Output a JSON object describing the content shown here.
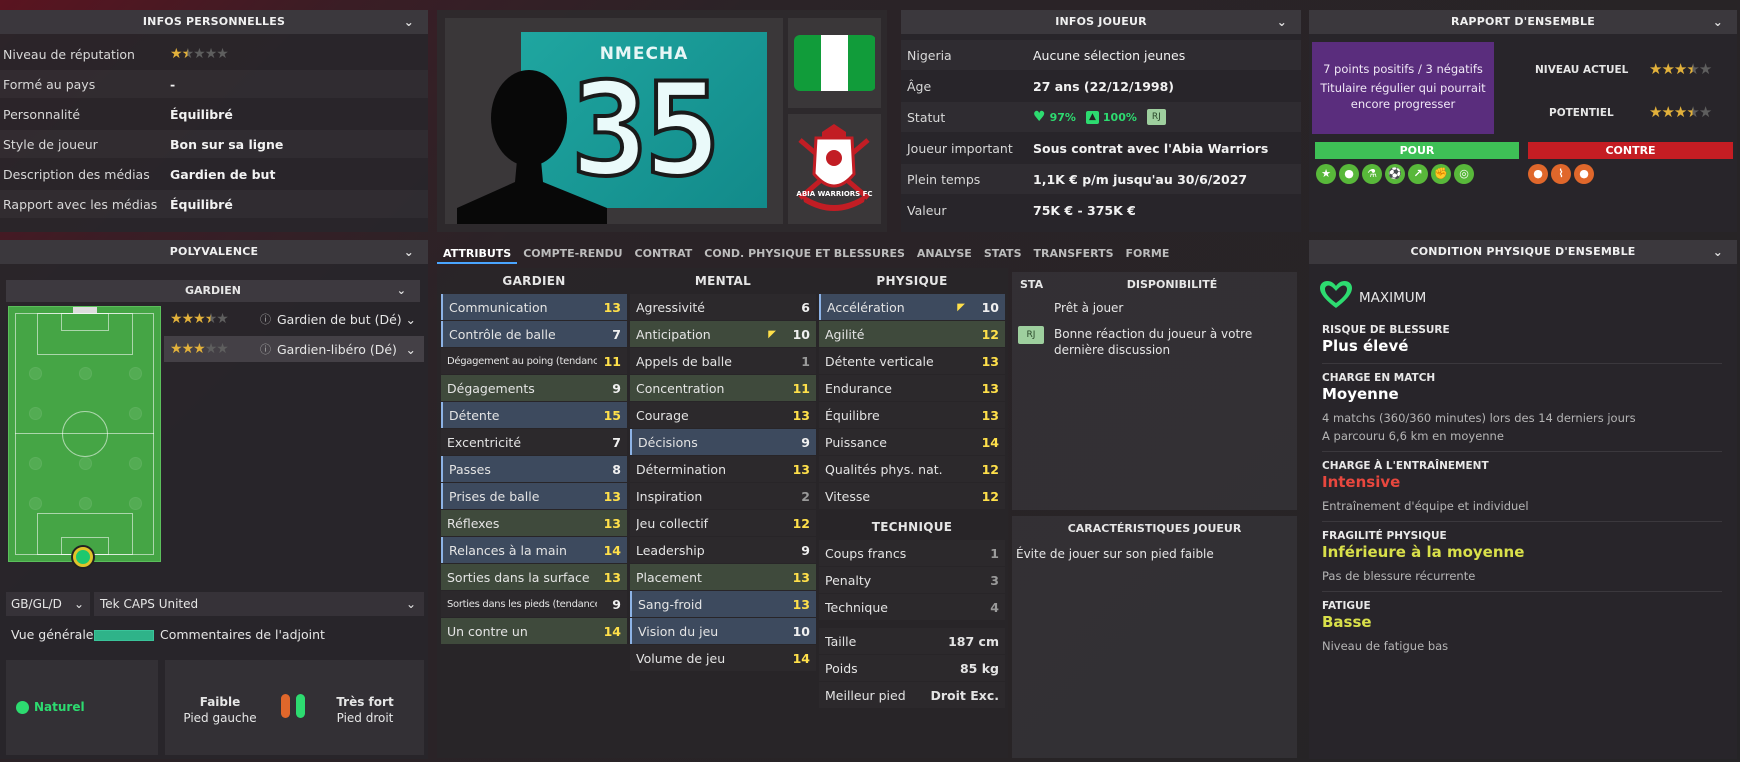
{
  "personal": {
    "title": "INFOS PERSONNELLES",
    "rows": [
      {
        "k": "Niveau de réputation",
        "v": "",
        "stars": 1.5
      },
      {
        "k": "Formé au pays",
        "v": "-"
      },
      {
        "k": "Personnalité",
        "v": "Équilibré"
      },
      {
        "k": "Style de joueur",
        "v": "Bon sur sa ligne"
      },
      {
        "k": "Description des médias",
        "v": "Gardien de but"
      },
      {
        "k": "Rapport avec les médias",
        "v": "Équilibré"
      }
    ]
  },
  "player": {
    "name": "NMECHA",
    "number": "35",
    "club": "ABIA WARRIORS FC",
    "flag_colors": [
      "#119c3a",
      "#ffffff",
      "#119c3a"
    ]
  },
  "info": {
    "title": "INFOS JOUEUR",
    "rows": [
      {
        "k": "Nigeria",
        "v": "Aucune sélection jeunes"
      },
      {
        "k": "Âge",
        "v": "27 ans (22/12/1998)"
      },
      {
        "k": "Statut",
        "heart": "97%",
        "thumb": "100%",
        "badge": "RJ"
      },
      {
        "k": "Joueur important",
        "v": "Sous contrat avec l'Abia Warriors"
      },
      {
        "k": "Plein temps",
        "v": "1,1K € p/m jusqu'au 30/6/2027"
      },
      {
        "k": "Valeur",
        "v": "75K € - 375K €"
      }
    ]
  },
  "overall": {
    "title": "RAPPORT D'ENSEMBLE",
    "summary": "7 points positifs / 3 négatifs",
    "desc": "Titulaire régulier qui pourrait encore progresser",
    "current_label": "NIVEAU ACTUEL",
    "current_stars": 3.5,
    "potential_label": "POTENTIEL",
    "potential_stars": 3.5,
    "pros": "POUR",
    "cons": "CONTRE",
    "pro_icons": [
      "star-icon",
      "ball-icon",
      "flask-icon",
      "kick-icon",
      "trend-icon",
      "strength-icon",
      "target-icon"
    ],
    "con_icons": [
      "ball-icon",
      "foot-icon",
      "ball-icon"
    ]
  },
  "versatility": {
    "title": "POLYVALENCE",
    "group": "GARDIEN",
    "roles": [
      {
        "stars": 3.5,
        "label": "Gardien de but (Dé)"
      },
      {
        "stars": 3,
        "label": "Gardien-libéro (Dé)"
      }
    ]
  },
  "filters": {
    "nation": "GB/GL/D",
    "source": "Tek CAPS United"
  },
  "overview": {
    "label": "Vue générale",
    "comments": "Commentaires de l'adjoint"
  },
  "feet": {
    "natural": "Naturel",
    "left_strength": "Faible",
    "left_label": "Pied gauche",
    "right_strength": "Très fort",
    "right_label": "Pied droit"
  },
  "tabs": [
    "ATTRIBUTS",
    "COMPTE-RENDU",
    "CONTRAT",
    "COND. PHYSIQUE ET BLESSURES",
    "ANALYSE",
    "STATS",
    "TRANSFERTS",
    "FORME"
  ],
  "attr": {
    "gk_title": "GARDIEN",
    "mental_title": "MENTAL",
    "phys_title": "PHYSIQUE",
    "tech_title": "TECHNIQUE",
    "gk": [
      {
        "n": "Communication",
        "v": "13",
        "c": "blue",
        "col": "y"
      },
      {
        "n": "Contrôle de balle",
        "v": "7",
        "c": "blue",
        "col": "w"
      },
      {
        "n": "Dégagement au poing (tendance)",
        "v": "11",
        "c": "plain",
        "col": "y",
        "small": true
      },
      {
        "n": "Dégagements",
        "v": "9",
        "c": "green",
        "col": "w"
      },
      {
        "n": "Détente",
        "v": "15",
        "c": "blue",
        "col": "y"
      },
      {
        "n": "Excentricité",
        "v": "7",
        "c": "plain",
        "col": "w"
      },
      {
        "n": "Passes",
        "v": "8",
        "c": "blue",
        "col": "w"
      },
      {
        "n": "Prises de balle",
        "v": "13",
        "c": "blue",
        "col": "y"
      },
      {
        "n": "Réflexes",
        "v": "13",
        "c": "green",
        "col": "y"
      },
      {
        "n": "Relances à la main",
        "v": "14",
        "c": "blue",
        "col": "y"
      },
      {
        "n": "Sorties dans la surface",
        "v": "13",
        "c": "green",
        "col": "y"
      },
      {
        "n": "Sorties dans les pieds (tendance)",
        "v": "9",
        "c": "plain",
        "col": "w",
        "small": true
      },
      {
        "n": "Un contre un",
        "v": "14",
        "c": "green",
        "col": "y"
      }
    ],
    "mental": [
      {
        "n": "Agressivité",
        "v": "6",
        "c": "plain",
        "col": "w"
      },
      {
        "n": "Anticipation",
        "v": "10",
        "c": "green",
        "col": "w",
        "arrow": true
      },
      {
        "n": "Appels de balle",
        "v": "1",
        "c": "plain",
        "col": "g"
      },
      {
        "n": "Concentration",
        "v": "11",
        "c": "green",
        "col": "y"
      },
      {
        "n": "Courage",
        "v": "13",
        "c": "plain",
        "col": "y"
      },
      {
        "n": "Décisions",
        "v": "9",
        "c": "blue",
        "col": "w"
      },
      {
        "n": "Détermination",
        "v": "13",
        "c": "plain",
        "col": "y"
      },
      {
        "n": "Inspiration",
        "v": "2",
        "c": "plain",
        "col": "g"
      },
      {
        "n": "Jeu collectif",
        "v": "12",
        "c": "plain",
        "col": "y"
      },
      {
        "n": "Leadership",
        "v": "9",
        "c": "plain",
        "col": "w"
      },
      {
        "n": "Placement",
        "v": "13",
        "c": "green",
        "col": "y"
      },
      {
        "n": "Sang-froid",
        "v": "13",
        "c": "blue",
        "col": "y"
      },
      {
        "n": "Vision du jeu",
        "v": "10",
        "c": "blue",
        "col": "w"
      },
      {
        "n": "Volume de jeu",
        "v": "14",
        "c": "plain",
        "col": "y"
      }
    ],
    "phys": [
      {
        "n": "Accélération",
        "v": "10",
        "c": "blue",
        "col": "w",
        "arrow": true
      },
      {
        "n": "Agilité",
        "v": "12",
        "c": "green",
        "col": "y"
      },
      {
        "n": "Détente verticale",
        "v": "13",
        "c": "plain",
        "col": "y"
      },
      {
        "n": "Endurance",
        "v": "13",
        "c": "plain",
        "col": "y"
      },
      {
        "n": "Équilibre",
        "v": "13",
        "c": "plain",
        "col": "y"
      },
      {
        "n": "Puissance",
        "v": "14",
        "c": "plain",
        "col": "y"
      },
      {
        "n": "Qualités phys. nat.",
        "v": "12",
        "c": "plain",
        "col": "y"
      },
      {
        "n": "Vitesse",
        "v": "12",
        "c": "plain",
        "col": "y"
      }
    ],
    "tech": [
      {
        "n": "Coups francs",
        "v": "1",
        "c": "plain",
        "col": "g"
      },
      {
        "n": "Penalty",
        "v": "3",
        "c": "plain",
        "col": "g"
      },
      {
        "n": "Technique",
        "v": "4",
        "c": "plain",
        "col": "g"
      }
    ],
    "bio": [
      {
        "k": "Taille",
        "v": "187 cm"
      },
      {
        "k": "Poids",
        "v": "85 kg"
      },
      {
        "k": "Meilleur pied",
        "v": "Droit Exc."
      }
    ]
  },
  "availability": {
    "sta": "STA",
    "title": "DISPONIBILITÉ",
    "rows": [
      {
        "badge": "",
        "text": "Prêt à jouer"
      },
      {
        "badge": "RJ",
        "text": "Bonne réaction du joueur à votre dernière discussion"
      }
    ]
  },
  "traits": {
    "title": "CARACTÉRISTIQUES JOUEUR",
    "items": [
      "Évite de jouer sur son pied faible"
    ]
  },
  "fitness": {
    "title": "CONDITION PHYSIQUE D'ENSEMBLE",
    "status": "MAXIMUM",
    "sections": [
      {
        "label": "RISQUE DE BLESSURE",
        "value": "Plus élevé",
        "color": "#ffffff",
        "notes": []
      },
      {
        "label": "CHARGE EN MATCH",
        "value": "Moyenne",
        "color": "#ffffff",
        "notes": [
          "4 matchs (360/360 minutes) lors des 14 derniers jours",
          "A parcouru 6,6 km en moyenne"
        ]
      },
      {
        "label": "CHARGE À L'ENTRAÎNEMENT",
        "value": "Intensive",
        "color": "#e8473e",
        "notes": [
          "Entraînement d'équipe et individuel"
        ]
      },
      {
        "label": "FRAGILITÉ PHYSIQUE",
        "value": "Inférieure à la moyenne",
        "color": "#d9e04a",
        "notes": [
          "Pas de blessure récurrente"
        ]
      },
      {
        "label": "FATIGUE",
        "value": "Basse",
        "color": "#d9e04a",
        "notes": [
          "Niveau de fatigue bas"
        ]
      }
    ]
  }
}
